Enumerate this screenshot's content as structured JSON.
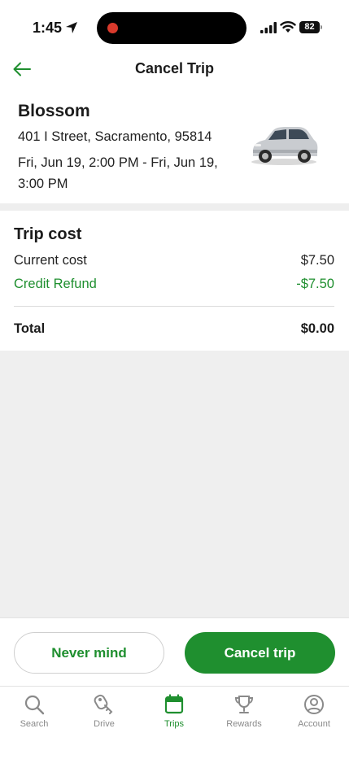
{
  "status_bar": {
    "time": "1:45",
    "battery": "82"
  },
  "header": {
    "title": "Cancel Trip"
  },
  "vehicle": {
    "name": "Blossom",
    "address": "401 I Street, Sacramento, 95814",
    "time_range": "Fri, Jun 19, 2:00 PM - Fri, Jun 19, 3:00 PM"
  },
  "trip_cost": {
    "title": "Trip cost",
    "current_label": "Current cost",
    "current_value": "$7.50",
    "refund_label": "Credit Refund",
    "refund_value": "-$7.50",
    "total_label": "Total",
    "total_value": "$0.00"
  },
  "actions": {
    "never_mind": "Never mind",
    "cancel": "Cancel trip"
  },
  "tabs": [
    {
      "label": "Search",
      "icon": "search-icon"
    },
    {
      "label": "Drive",
      "icon": "key-icon"
    },
    {
      "label": "Trips",
      "icon": "calendar-icon",
      "active": true
    },
    {
      "label": "Rewards",
      "icon": "trophy-icon"
    },
    {
      "label": "Account",
      "icon": "account-icon"
    }
  ],
  "colors": {
    "accent": "#1f8f2f",
    "recording": "#d93a2c"
  }
}
